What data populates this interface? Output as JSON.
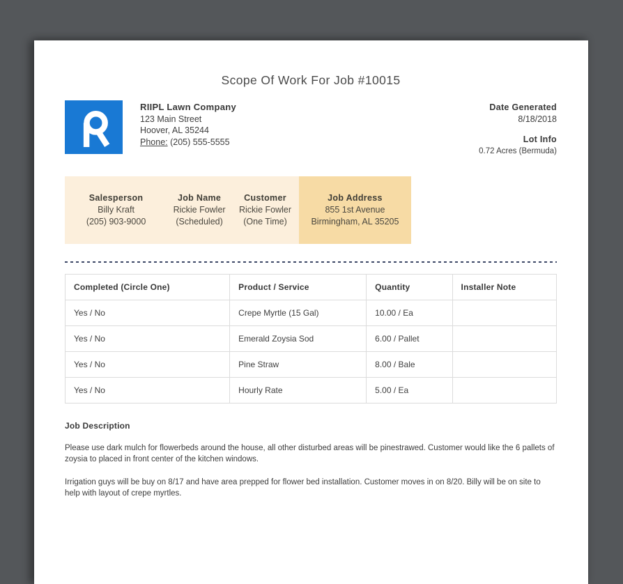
{
  "page": {
    "title": "Scope Of Work For Job #10015"
  },
  "company": {
    "logo_letter": "R",
    "name": "RIIPL Lawn Company",
    "address_line1": "123 Main Street",
    "address_line2": "Hoover, AL 35244",
    "phone_label": "Phone:",
    "phone": "(205) 555-5555"
  },
  "meta": {
    "date_generated_label": "Date Generated",
    "date_generated": "8/18/2018",
    "lot_info_label": "Lot Info",
    "lot_info": "0.72 Acres (Bermuda)"
  },
  "job_summary": {
    "cells": [
      {
        "label": "Salesperson",
        "line1": "Billy Kraft",
        "line2": "(205) 903-9000"
      },
      {
        "label": "Job Name",
        "line1": "Rickie Fowler",
        "line2": "(Scheduled)"
      },
      {
        "label": "Customer",
        "line1": "Rickie Fowler",
        "line2": "(One Time)"
      },
      {
        "label": "Job Address",
        "line1": "855 1st Avenue",
        "line2": "Birmingham, AL 35205"
      }
    ]
  },
  "work_table": {
    "headers": [
      "Completed (Circle One)",
      "Product / Service",
      "Quantity",
      "Installer Note"
    ],
    "rows": [
      [
        "Yes / No",
        "Crepe Myrtle (15 Gal)",
        "10.00 / Ea",
        ""
      ],
      [
        "Yes / No",
        "Emerald Zoysia Sod",
        "6.00 / Pallet",
        ""
      ],
      [
        "Yes / No",
        "Pine Straw",
        "8.00 / Bale",
        ""
      ],
      [
        "Yes / No",
        "Hourly Rate",
        "5.00 / Ea",
        ""
      ]
    ]
  },
  "job_description": {
    "heading": "Job Description",
    "paragraphs": [
      "Please use dark mulch for flowerbeds around the house, all other disturbed areas will be pinestrawed. Customer would like the 6 pallets of zoysia to placed in front center of the kitchen windows.",
      "Irrigation guys will be buy on 8/17 and have area prepped for flower bed installation. Customer moves in on 8/20. Billy will be on site to help with layout of crepe myrtles."
    ]
  },
  "colors": {
    "backdrop": "#54575a",
    "page": "#ffffff",
    "logo_blue": "#1979d4",
    "band_light": "#fcefdc",
    "band_highlight": "#f7dba5",
    "dash_line": "#3c4766",
    "table_border": "#dcdcdc",
    "text": "#3e3e3e"
  }
}
